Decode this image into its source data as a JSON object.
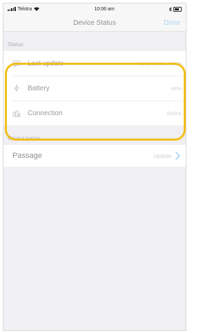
{
  "statusbar": {
    "carrier": "Telstra",
    "time": "10:06 am"
  },
  "navbar": {
    "title": "Device Status",
    "done_label": "Done"
  },
  "status": {
    "header": "Status",
    "rows": [
      {
        "label": "Last update",
        "value": "09:58 28 Mar 2018",
        "icon": "message-icon"
      },
      {
        "label": "Battery",
        "value": "64%",
        "icon": "lightning-icon"
      },
      {
        "label": "Connection",
        "value": "Online",
        "icon": "connection-icon"
      }
    ]
  },
  "device_name": {
    "header": "Device name",
    "name": "Passage",
    "action_label": "Update"
  },
  "colors": {
    "accent": "#a9d6f5",
    "highlight": "#f2be1a",
    "background": "#efeff4"
  }
}
